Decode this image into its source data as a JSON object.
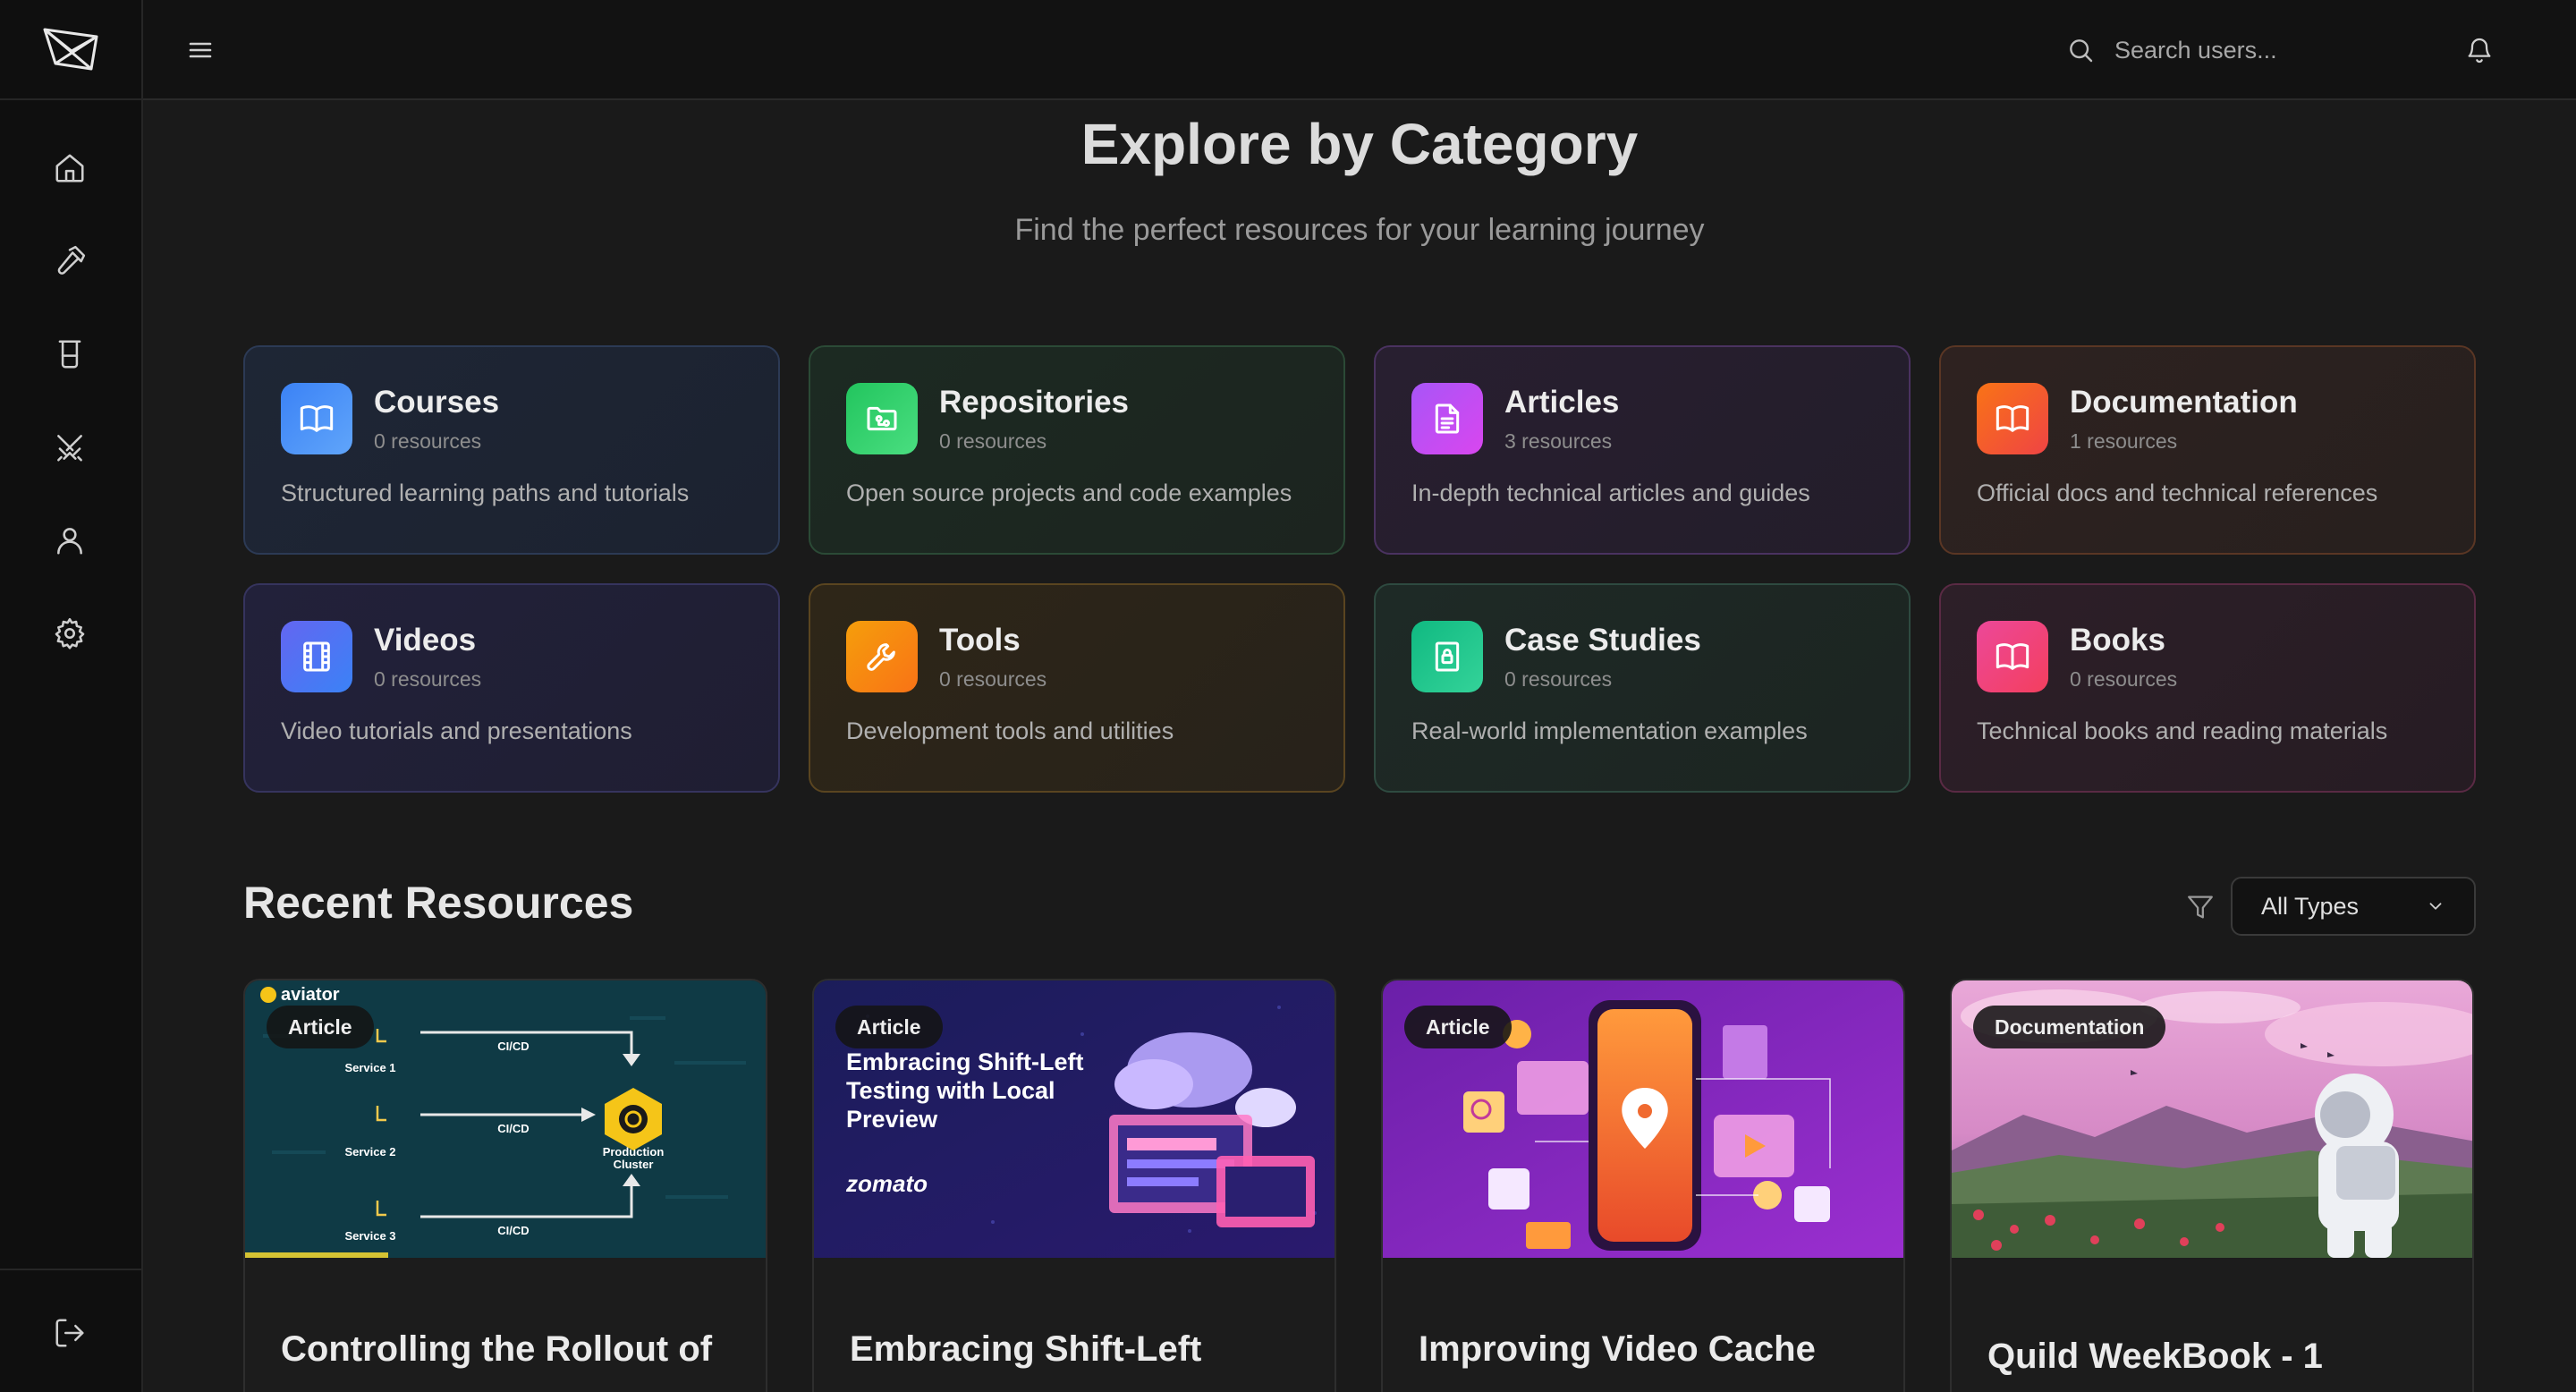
{
  "topbar": {
    "search_placeholder": "Search users..."
  },
  "sidebar": {
    "items": [
      {
        "icon": "home-icon"
      },
      {
        "icon": "hammer-icon"
      },
      {
        "icon": "beaker-icon"
      },
      {
        "icon": "crossed-swords-icon"
      },
      {
        "icon": "user-icon"
      },
      {
        "icon": "gear-icon"
      }
    ],
    "logout_icon": "logout-icon"
  },
  "hero": {
    "title": "Explore by Category",
    "subtitle": "Find the perfect resources for your learning journey"
  },
  "categories": [
    {
      "name": "Courses",
      "count": "0 resources",
      "desc": "Structured learning paths and tutorials",
      "color": "#3b82f6",
      "icon": "book-open-icon"
    },
    {
      "name": "Repositories",
      "count": "0 resources",
      "desc": "Open source projects and code examples",
      "color": "#22c55e",
      "icon": "folder-git-icon"
    },
    {
      "name": "Articles",
      "count": "3 resources",
      "desc": "In-depth technical articles and guides",
      "color": "#a855f7",
      "icon": "document-icon"
    },
    {
      "name": "Documentation",
      "count": "1 resources",
      "desc": "Official docs and technical references",
      "color": "#f97316",
      "icon": "book-open-icon"
    },
    {
      "name": "Videos",
      "count": "0 resources",
      "desc": "Video tutorials and presentations",
      "color": "#6366f1",
      "icon": "film-icon"
    },
    {
      "name": "Tools",
      "count": "0 resources",
      "desc": "Development tools and utilities",
      "color": "#f59e0b",
      "icon": "wrench-icon"
    },
    {
      "name": "Case Studies",
      "count": "0 resources",
      "desc": "Real-world implementation examples",
      "color": "#10b981",
      "icon": "file-lock-icon"
    },
    {
      "name": "Books",
      "count": "0 resources",
      "desc": "Technical books and reading materials",
      "color": "#ec4899",
      "icon": "book-open-icon"
    }
  ],
  "recent": {
    "title": "Recent Resources",
    "filter_value": "All Types",
    "items": [
      {
        "badge": "Article",
        "title": "Controlling the Rollout of",
        "thumb": {
          "brand": "aviator",
          "pipeline_labels": [
            "CI/CD",
            "CI/CD",
            "CI/CD"
          ],
          "services": [
            "Service 1",
            "Service 2",
            "Service 3"
          ],
          "target": [
            "Production",
            "Cluster"
          ]
        }
      },
      {
        "badge": "Article",
        "title": "Embracing Shift-Left",
        "thumb": {
          "headline": [
            "Embracing Shift-Left",
            "Testing with Local",
            "Preview"
          ],
          "brand": "zomato"
        }
      },
      {
        "badge": "Article",
        "title": "Improving Video Cache"
      },
      {
        "badge": "Documentation",
        "title": "Quild WeekBook - 1"
      }
    ]
  }
}
